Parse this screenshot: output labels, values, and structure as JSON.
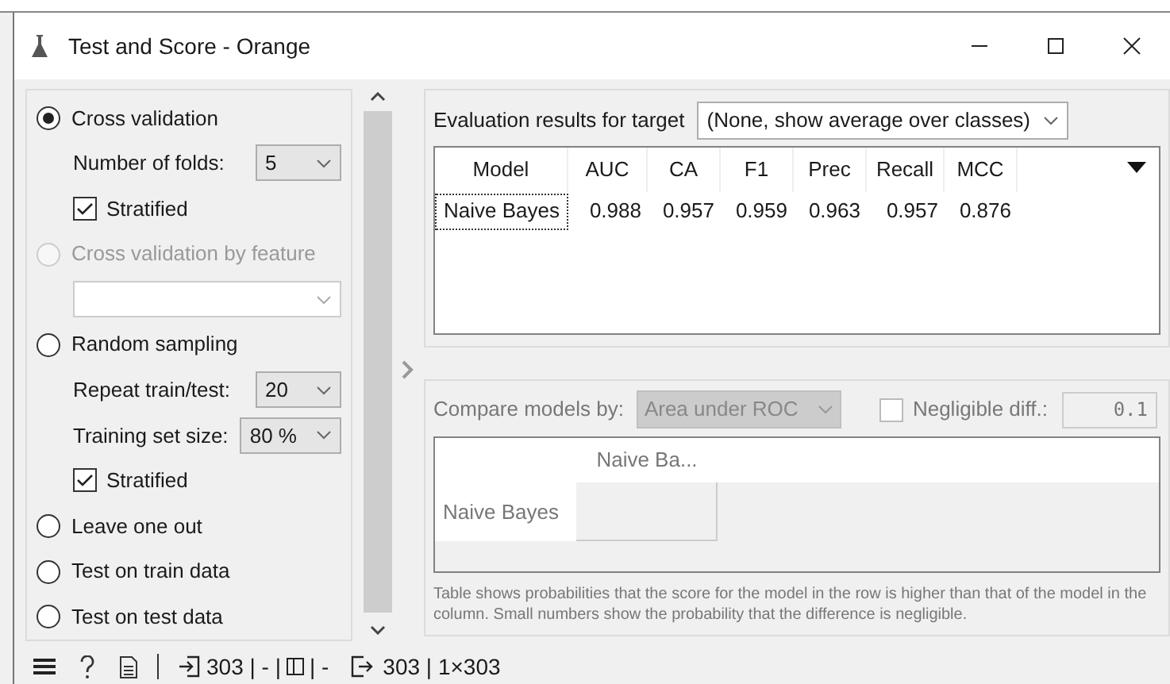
{
  "window": {
    "title": "Test and Score - Orange"
  },
  "sampling": [
    {
      "kind": "radio",
      "label": "Cross validation",
      "selected": true,
      "disabled": false
    },
    {
      "kind": "select",
      "label": "Number of folds:",
      "value": "5"
    },
    {
      "kind": "checkbox",
      "label": "Stratified",
      "checked": true
    },
    {
      "kind": "radio",
      "label": "Cross validation by feature",
      "selected": false,
      "disabled": true
    },
    {
      "kind": "combo"
    },
    {
      "kind": "radio",
      "label": "Random sampling",
      "selected": false,
      "disabled": false
    },
    {
      "kind": "select",
      "label": "Repeat train/test:",
      "value": "20"
    },
    {
      "kind": "select",
      "label": "Training set size:",
      "value": "80 %"
    },
    {
      "kind": "checkbox",
      "label": "Stratified",
      "checked": true
    },
    {
      "kind": "radio",
      "label": "Leave one out",
      "selected": false,
      "disabled": false
    },
    {
      "kind": "radio",
      "label": "Test on train data",
      "selected": false,
      "disabled": false
    },
    {
      "kind": "radio",
      "label": "Test on test data",
      "selected": false,
      "disabled": false
    }
  ],
  "evaluation": {
    "label": "Evaluation results for target",
    "target": "(None, show average over classes)",
    "table": {
      "columns": [
        "Model",
        "AUC",
        "CA",
        "F1",
        "Prec",
        "Recall",
        "MCC"
      ],
      "rows": [
        {
          "cells": [
            "Naive Bayes",
            "0.988",
            "0.957",
            "0.959",
            "0.963",
            "0.957",
            "0.876"
          ],
          "selected": true
        }
      ]
    }
  },
  "compare": {
    "label": "Compare models by:",
    "value": "Area under ROC",
    "disabled": true,
    "negligible": {
      "label": "Negligible diff.:",
      "checked": false,
      "value": "0.1"
    },
    "table": {
      "columns": [
        "Naive Ba..."
      ],
      "rows": [
        "Naive Bayes"
      ]
    },
    "note": "Table shows probabilities that the score for the model in the row is higher than that of the model in the column. Small numbers show the probability that the difference is negligible."
  },
  "status_bar": {
    "input": "303 | - |",
    "table": "| -",
    "output": "303 | 1×303"
  }
}
